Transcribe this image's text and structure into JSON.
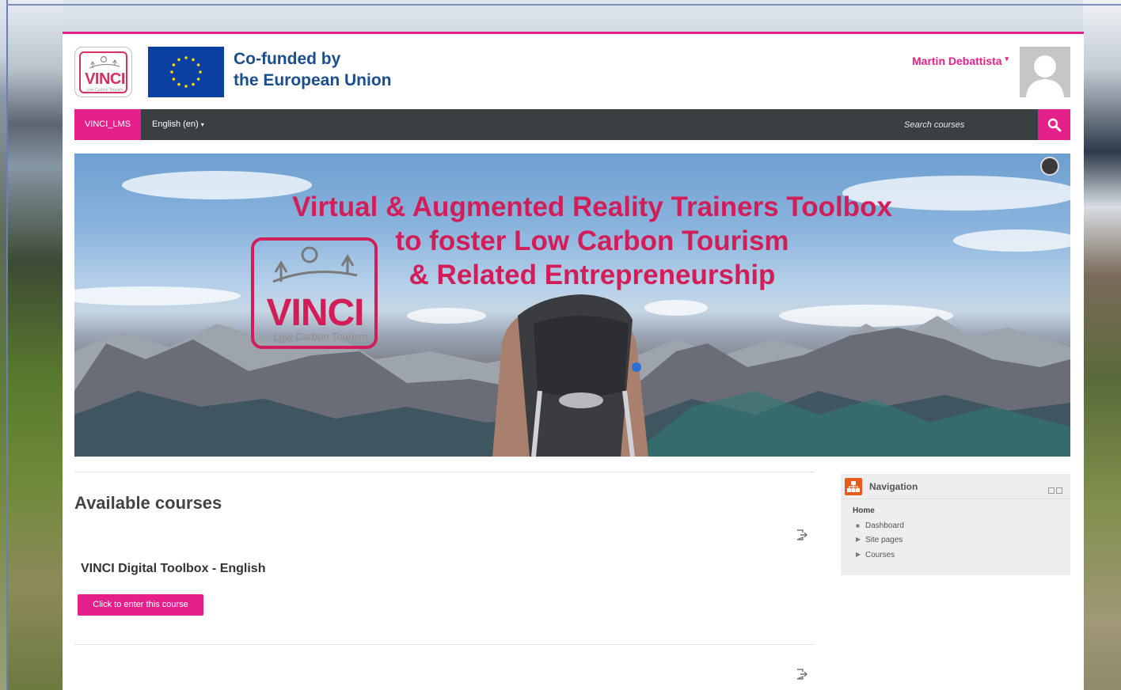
{
  "header": {
    "logo_text": "VINCI",
    "logo_tagline": "Low Carbon Tourism",
    "eu_line1": "Co-funded by",
    "eu_line2": "the European Union",
    "user_name": "Martin Debattista"
  },
  "navbar": {
    "brand": "VINCI_LMS",
    "language": "English (en)",
    "search_placeholder": "Search courses"
  },
  "banner": {
    "line1": "Virtual & Augmented Reality Trainers Toolbox",
    "line2": "to foster Low Carbon Tourism",
    "line3": "& Related Entrepreneurship",
    "logo_text": "VINCI",
    "logo_tagline": "Low Carbon Tourism"
  },
  "main": {
    "title": "Available courses",
    "courses": [
      {
        "name": "VINCI Digital Toolbox - English",
        "button_label": "Click to enter this course"
      }
    ]
  },
  "navigation": {
    "title": "Navigation",
    "home": "Home",
    "items": [
      {
        "label": "Dashboard",
        "marker": "bullet"
      },
      {
        "label": "Site pages",
        "marker": "collapsed"
      },
      {
        "label": "Courses",
        "marker": "collapsed"
      }
    ]
  },
  "colors": {
    "accent": "#e5208a",
    "navbar_bg": "#3a3f41",
    "banner_title": "#d21e58",
    "eu_blue": "#0b3fa1",
    "eu_text": "#1a4e8f",
    "nav_icon": "#ea5a1a"
  }
}
